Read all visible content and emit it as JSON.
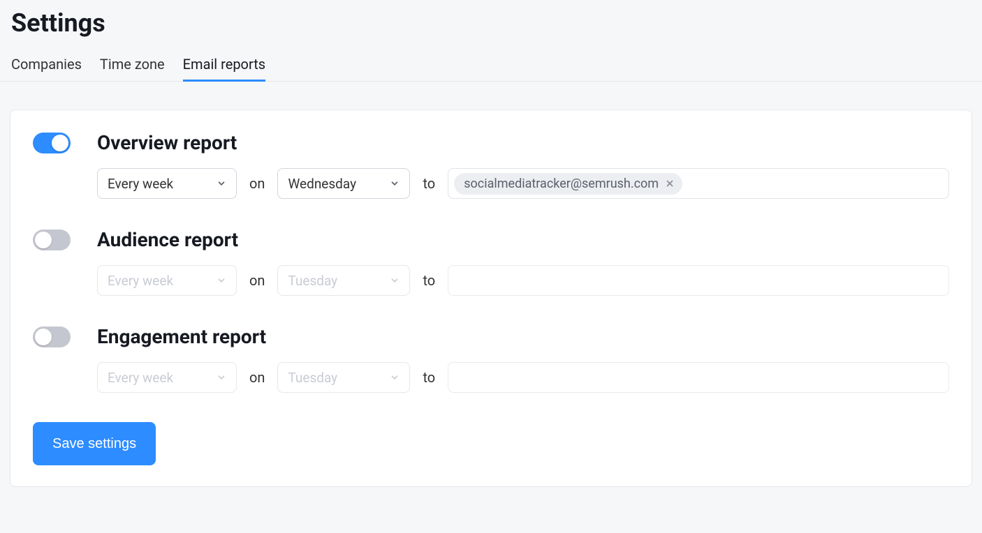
{
  "title": "Settings",
  "tabs": [
    {
      "label": "Companies",
      "active": false
    },
    {
      "label": "Time zone",
      "active": false
    },
    {
      "label": "Email reports",
      "active": true
    }
  ],
  "labels": {
    "on": "on",
    "to": "to"
  },
  "reports": [
    {
      "title": "Overview report",
      "enabled": true,
      "frequency": "Every week",
      "day": "Wednesday",
      "emails": [
        "socialmediatracker@semrush.com"
      ]
    },
    {
      "title": "Audience report",
      "enabled": false,
      "frequency": "Every week",
      "day": "Tuesday",
      "emails": []
    },
    {
      "title": "Engagement report",
      "enabled": false,
      "frequency": "Every week",
      "day": "Tuesday",
      "emails": []
    }
  ],
  "save_label": "Save settings"
}
